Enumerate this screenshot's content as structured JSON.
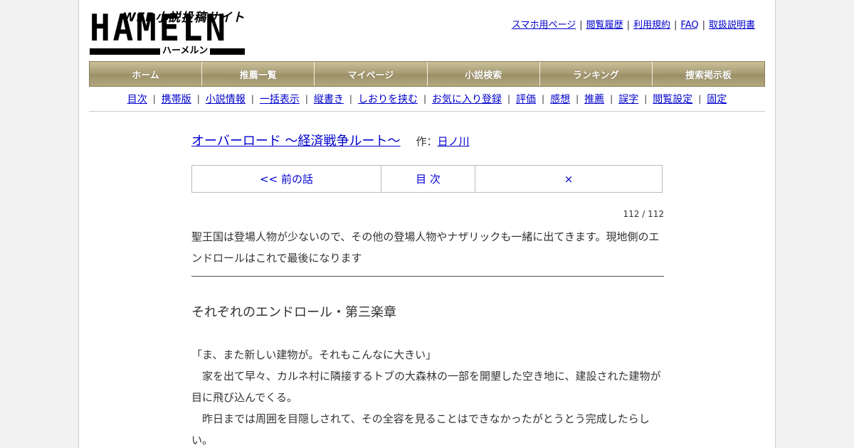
{
  "logo": {
    "tagline": "WEB小説投稿サイト",
    "wordmark": "HAMELN",
    "kana": "ハーメルン"
  },
  "toplinks": [
    "スマホ用ページ",
    "閲覧履歴",
    "利用規約",
    "FAQ",
    "取扱説明書"
  ],
  "mainnav": [
    "ホーム",
    "推薦一覧",
    "マイページ",
    "小説検索",
    "ランキング",
    "捜索掲示板"
  ],
  "subnav": [
    "目次",
    "携帯版",
    "小説情報",
    "一括表示",
    "縦書き",
    "しおりを挟む",
    "お気に入り登録",
    "評価",
    "感想",
    "推薦",
    "誤字",
    "閲覧設定",
    "固定"
  ],
  "novel": {
    "title": "オーバーロード ～経済戦争ルート～",
    "author_prefix": "作：",
    "author": "日ノ川"
  },
  "chapnav": {
    "prev": "<< 前の話",
    "toc": "目 次",
    "close": "×"
  },
  "counter": "112 / 112",
  "preface": "聖王国は登場人物が少ないので、その他の登場人物やナザリックも一緒に出てきます。現地側のエンドロールはこれで最後になります",
  "chapter_title": "それぞれのエンドロール・第三楽章",
  "body": [
    "「ま、また新しい建物が。それもこんなに大きい」",
    "　家を出て早々、カルネ村に隣接するトブの大森林の一部を開墾した空き地に、建設された建物が目に飛び込んでくる。",
    "　昨日までは周囲を目隠しされて、その全容を見ることはできなかったがとうとう完成したらしい。"
  ]
}
